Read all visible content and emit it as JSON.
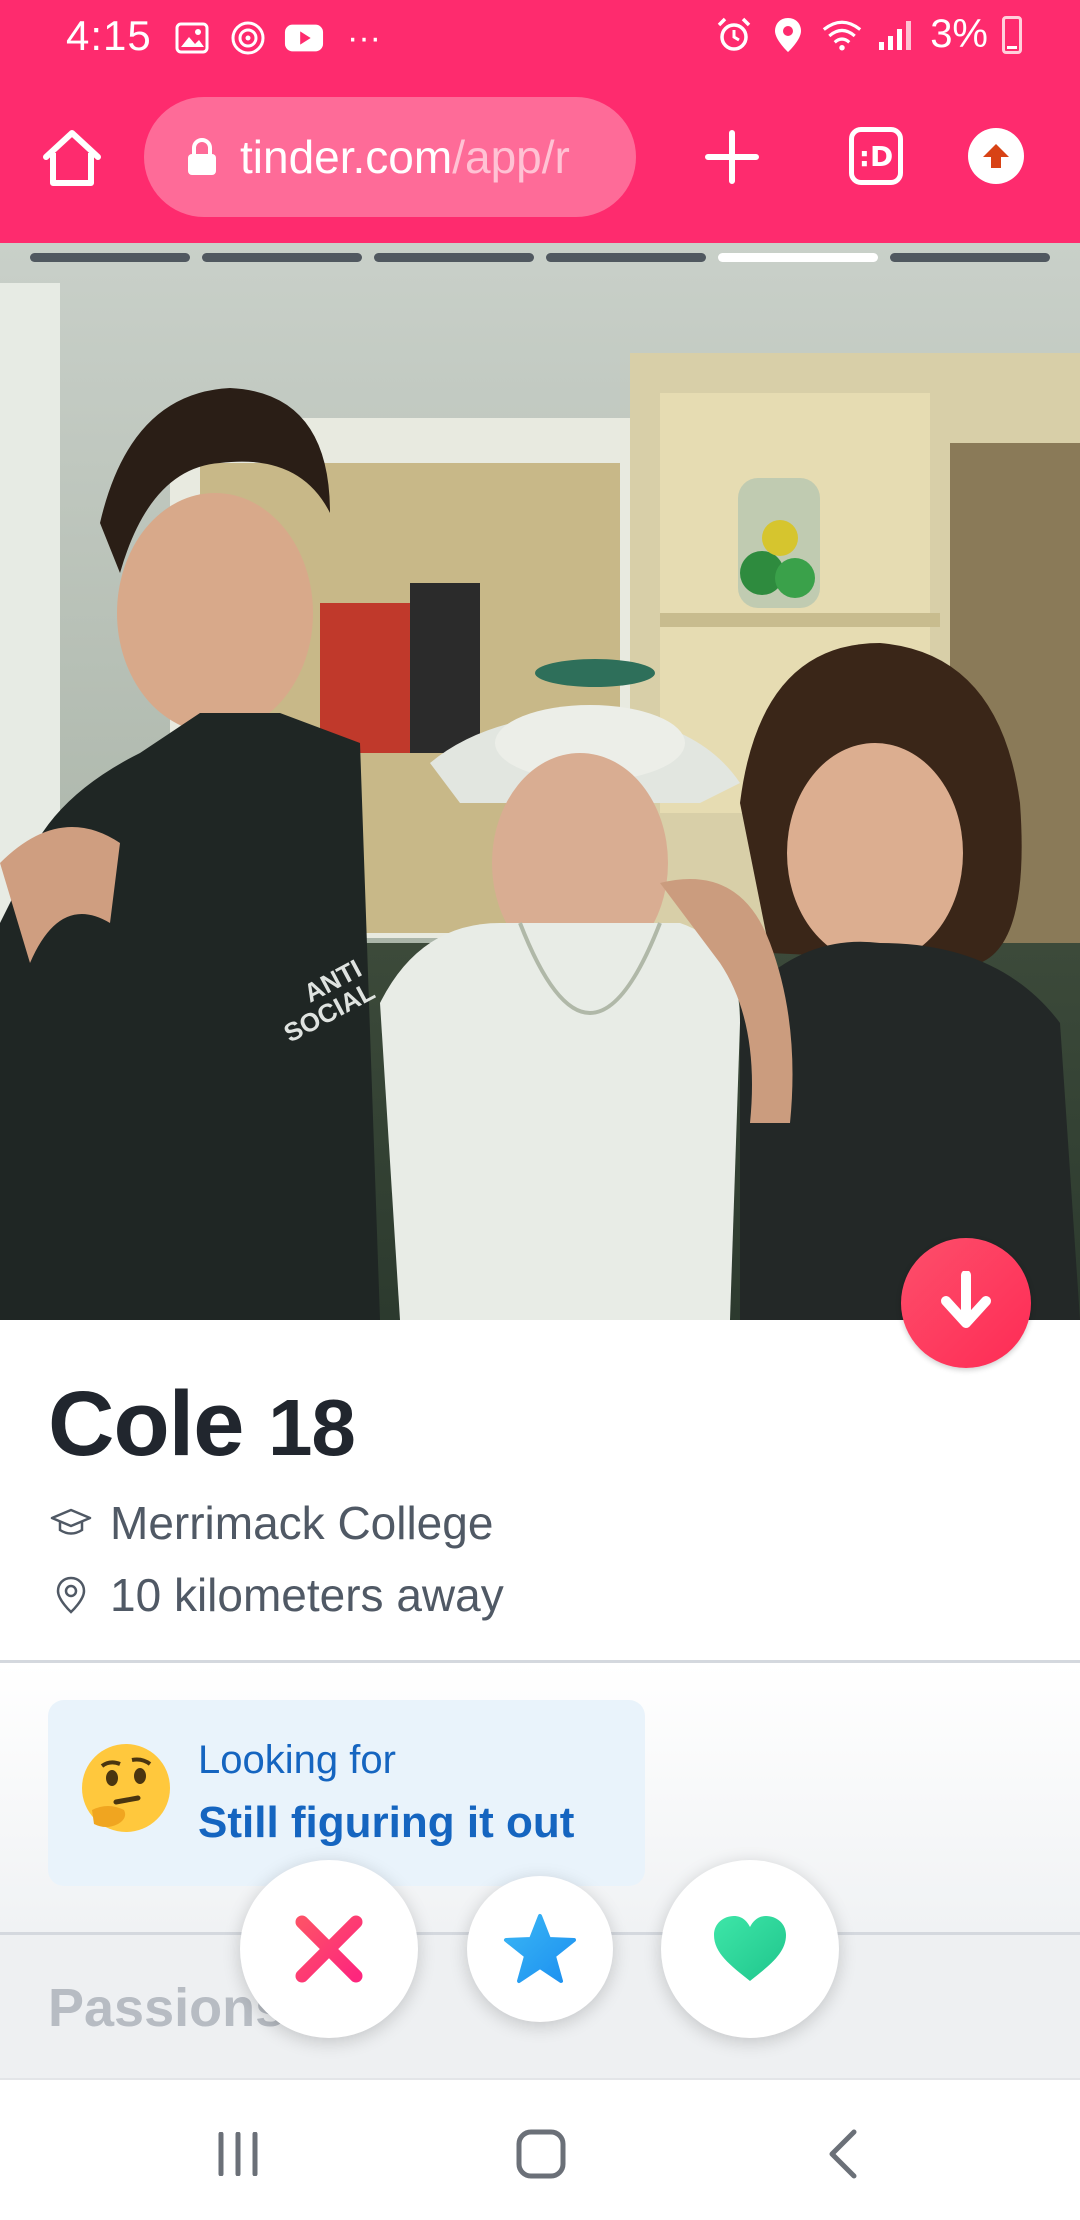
{
  "status_bar": {
    "time": "4:15",
    "left_icons": [
      "image-icon",
      "vpn-icon",
      "youtube-icon",
      "more-icon"
    ],
    "right_icons": [
      "alarm-icon",
      "location-icon",
      "wifi-icon",
      "signal-icon"
    ],
    "battery": "3%",
    "more": "···"
  },
  "browser": {
    "url_host": "tinder.com",
    "url_path": "/app/r",
    "tab_count_label": ":D",
    "brand_color": "#fe2b6e"
  },
  "photo": {
    "total_photos": 6,
    "active_index": 5
  },
  "profile": {
    "name": "Cole",
    "age": "18",
    "school": "Merrimack College",
    "distance": "10 kilometers away"
  },
  "looking_for": {
    "label": "Looking for",
    "value": "Still figuring it out",
    "emoji": "thinking-face"
  },
  "passions": {
    "title": "Passions"
  },
  "actions": {
    "nope": "nope-x-icon",
    "super_like": "star-icon",
    "like": "heart-icon"
  },
  "nav": [
    "recents-icon",
    "home-icon",
    "back-icon"
  ]
}
